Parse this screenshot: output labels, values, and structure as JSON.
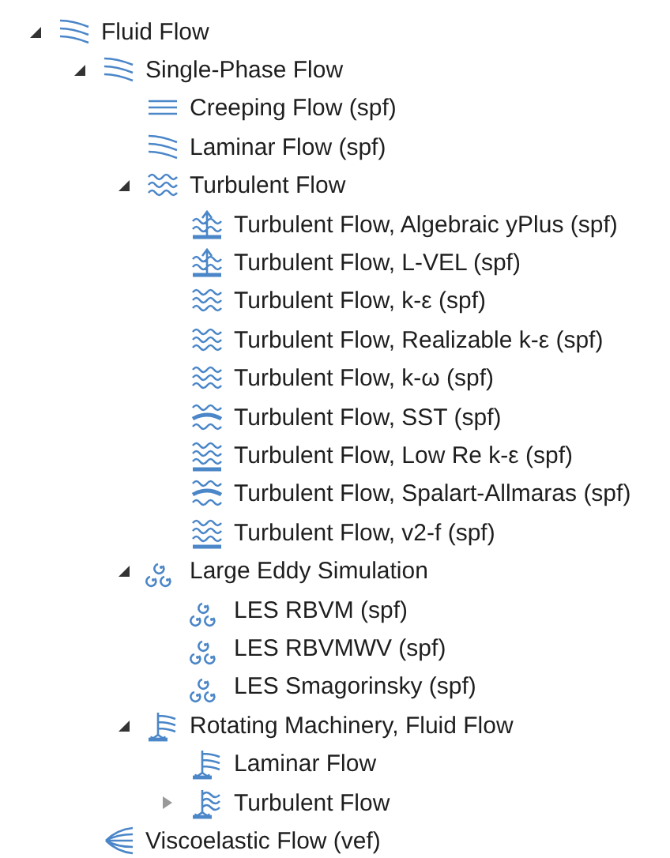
{
  "tree": [
    {
      "label": "Fluid Flow",
      "kind": "laminar",
      "expanded": true,
      "children": [
        {
          "label": "Single-Phase Flow",
          "kind": "laminar",
          "expanded": true,
          "children": [
            {
              "label": "Creeping Flow (spf)",
              "kind": "creeping"
            },
            {
              "label": "Laminar Flow (spf)",
              "kind": "laminar"
            },
            {
              "label": "Turbulent Flow",
              "kind": "turbulent",
              "expanded": true,
              "children": [
                {
                  "label": "Turbulent Flow, Algebraic yPlus (spf)",
                  "kind": "wall-arrow"
                },
                {
                  "label": "Turbulent Flow, L-VEL (spf)",
                  "kind": "wall-arrow"
                },
                {
                  "label": "Turbulent Flow, k-ε (spf)",
                  "kind": "turbulent"
                },
                {
                  "label": "Turbulent Flow, Realizable k-ε (spf)",
                  "kind": "turbulent"
                },
                {
                  "label": "Turbulent Flow, k-ω (spf)",
                  "kind": "turbulent"
                },
                {
                  "label": "Turbulent Flow, SST (spf)",
                  "kind": "band"
                },
                {
                  "label": "Turbulent Flow, Low Re k-ε (spf)",
                  "kind": "wall"
                },
                {
                  "label": "Turbulent Flow, Spalart-Allmaras (spf)",
                  "kind": "band"
                },
                {
                  "label": "Turbulent Flow, v2-f (spf)",
                  "kind": "wall"
                }
              ]
            },
            {
              "label": "Large Eddy Simulation",
              "kind": "eddy",
              "expanded": true,
              "children": [
                {
                  "label": "LES RBVM (spf)",
                  "kind": "eddy"
                },
                {
                  "label": "LES RBVMWV (spf)",
                  "kind": "eddy"
                },
                {
                  "label": "LES Smagorinsky (spf)",
                  "kind": "eddy"
                }
              ]
            },
            {
              "label": "Rotating Machinery, Fluid Flow",
              "kind": "rotor",
              "expanded": true,
              "children": [
                {
                  "label": "Laminar Flow",
                  "kind": "rotor"
                },
                {
                  "label": "Turbulent Flow",
                  "kind": "rotor-turbulent",
                  "expanded": false
                }
              ]
            }
          ]
        },
        {
          "label": "Viscoelastic Flow (vef)",
          "kind": "fan"
        }
      ]
    }
  ]
}
